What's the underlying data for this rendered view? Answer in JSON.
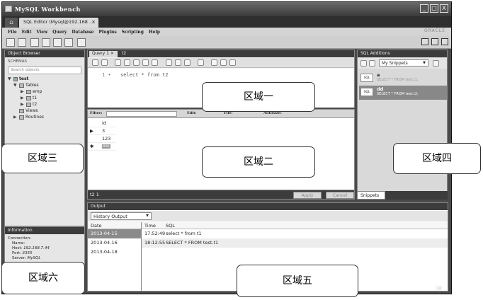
{
  "window": {
    "title": "MySQL Workbench",
    "controls": [
      "_",
      "□",
      "X"
    ]
  },
  "tabs": {
    "home": "⌂",
    "editor": "SQL Editor (Mysql@192.168 ...",
    "close": "×"
  },
  "menu": [
    "File",
    "Edit",
    "View",
    "Query",
    "Database",
    "Plugins",
    "Scripting",
    "Help"
  ],
  "brand": "ORACLE",
  "object_browser": {
    "header": "Object Browser",
    "schemas_label": "SCHEMAS",
    "search_placeholder": "Search objects",
    "tree": {
      "db": "test",
      "tables": "Tables",
      "items": [
        "emp",
        "t1",
        "t2"
      ],
      "views": "Views",
      "routines": "Routines"
    }
  },
  "information": {
    "header": "Information",
    "connection": "Connection:",
    "name_label": "Name:",
    "host_label": "Host:",
    "host": "192.168.7.44",
    "port_label": "Port:",
    "port": "3355",
    "server_label": "Server:",
    "server": "MySQL"
  },
  "query": {
    "tabs": [
      "Query 1",
      "t2"
    ],
    "line_no": "1",
    "text": "select * from t2"
  },
  "result": {
    "filter_label": "Filter:",
    "edit_label": "Edit:",
    "file_label": "File:",
    "autosize_label": "Autosize:",
    "column": "id",
    "rows": [
      "3",
      "123"
    ],
    "null": "NULL",
    "tab": "t2 1",
    "apply": "Apply",
    "cancel": "Cancel"
  },
  "sql_additions": {
    "header": "SQL Additions",
    "select": "My Snippets",
    "icon_label": "SQL",
    "snippets": [
      {
        "name": "a",
        "query": "SELECT * FROM test.t1;"
      },
      {
        "name": "dd",
        "query": "SELECT * FROM test.t2;"
      }
    ],
    "tab": "Snippets"
  },
  "output": {
    "header": "Output",
    "select": "History Output",
    "date_header": "Date",
    "dates": [
      "2013-04-15",
      "2013-04-16",
      "2013-04-18"
    ],
    "time_header": "Time",
    "sql_header": "SQL",
    "logs": [
      {
        "time": "17:52:49",
        "sql": "select * from t1"
      },
      {
        "time": "18:12:55",
        "sql": "SELECT * FROM test.t1"
      }
    ]
  },
  "callouts": {
    "one": "区域一",
    "two": "区域二",
    "three": "区域三",
    "four": "区域四",
    "five": "区域五",
    "six": "区域六"
  },
  "colors": {
    "chrome_dark": "#3c3c3c",
    "panel_light": "#e6e6e6",
    "selection": "#8a8a8a"
  }
}
